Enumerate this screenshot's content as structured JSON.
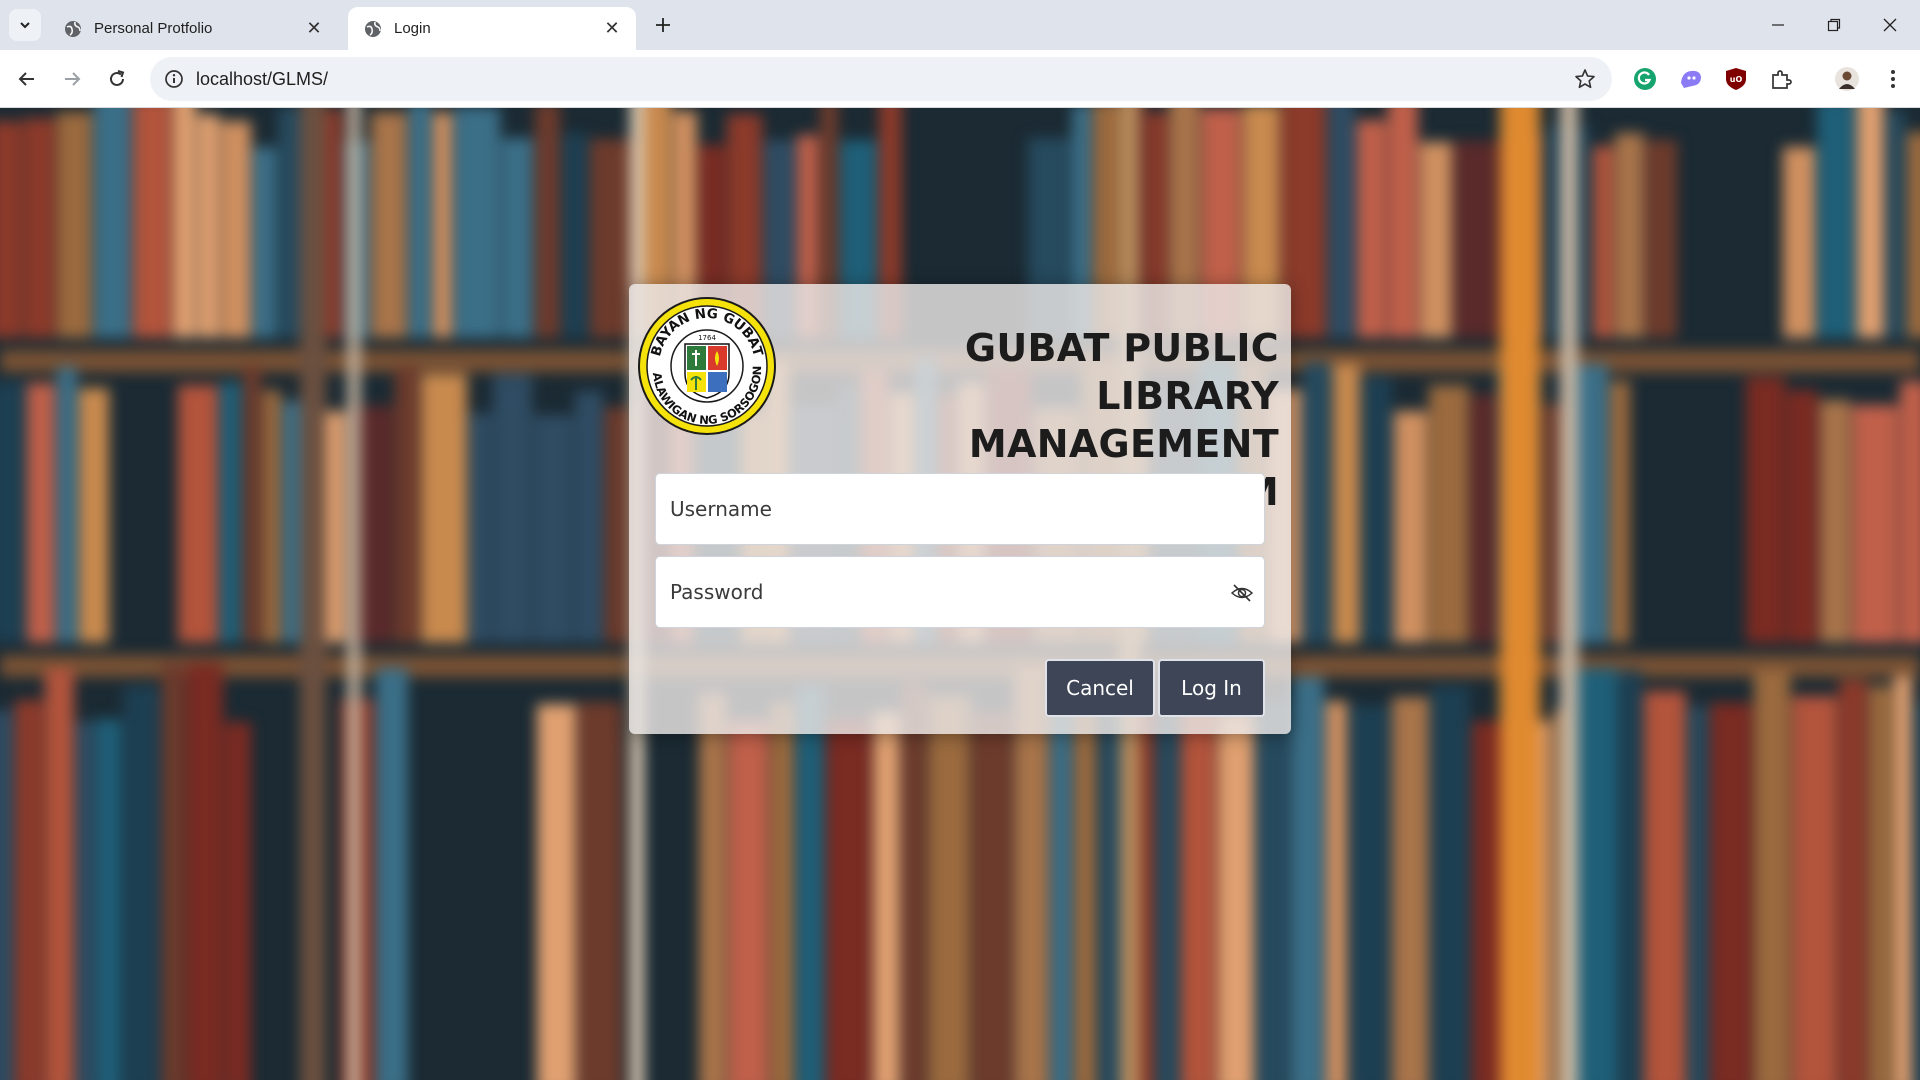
{
  "browser": {
    "tabs": [
      {
        "title": "Personal Protfolio",
        "active": false
      },
      {
        "title": "Login",
        "active": true
      }
    ],
    "url": "localhost/GLMS/",
    "icons": {
      "tab_search": "chevron-down-icon",
      "new_tab": "plus-icon",
      "back": "arrow-left-icon",
      "forward": "arrow-right-icon",
      "reload": "reload-icon",
      "site_info": "info-icon",
      "bookmark": "star-icon",
      "extensions": [
        "grammarly-icon",
        "ai-extension-icon",
        "ublock-icon",
        "puzzle-icon"
      ],
      "profile": "avatar-icon",
      "menu": "kebab-menu-icon"
    },
    "window_controls": [
      "minimize",
      "restore",
      "close"
    ]
  },
  "login": {
    "title_line1": "GUBAT PUBLIC LIBRARY",
    "title_line2": "MANAGEMENT SYSTEM",
    "seal": {
      "top_text": "BAYAN NG GUBAT",
      "bottom_text": "LALAWIGAN NG SORSOGON",
      "year": "1764"
    },
    "username_placeholder": "Username",
    "password_placeholder": "Password",
    "cancel_label": "Cancel",
    "login_label": "Log In"
  },
  "colors": {
    "button_bg": "#3d4557",
    "card_bg": "rgba(235,232,230,0.82)",
    "chrome_bg": "#dfe3eb"
  }
}
